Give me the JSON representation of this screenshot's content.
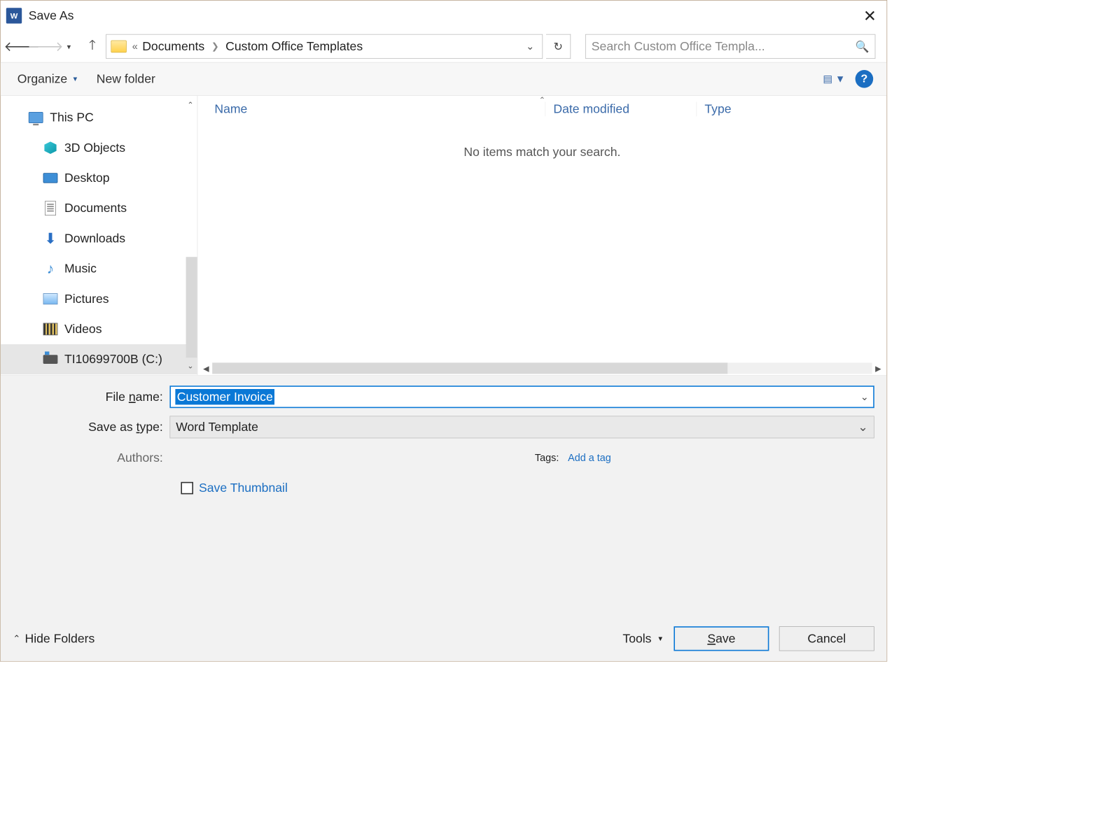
{
  "title": "Save As",
  "breadcrumb": {
    "parent": "Documents",
    "current": "Custom Office Templates"
  },
  "search_placeholder": "Search Custom Office Templa...",
  "toolbar": {
    "organize": "Organize",
    "new_folder": "New folder"
  },
  "tree": {
    "root": "This PC",
    "items": [
      "3D Objects",
      "Desktop",
      "Documents",
      "Downloads",
      "Music",
      "Pictures",
      "Videos",
      "TI10699700B (C:)"
    ]
  },
  "columns": {
    "name": "Name",
    "date": "Date modified",
    "type": "Type"
  },
  "empty_message": "No items match your search.",
  "form": {
    "filename_label_pre": "File ",
    "filename_label_u": "n",
    "filename_label_post": "ame:",
    "filename_value": "Customer Invoice",
    "type_label_pre": "Save as ",
    "type_label_u": "t",
    "type_label_post": "ype:",
    "type_value": "Word Template",
    "authors_label": "Authors:",
    "authors_value": "",
    "tags_label": "Tags:",
    "tags_value": "Add a tag",
    "thumbnail_label": "Save Thumbnail"
  },
  "footer": {
    "hide_folders": "Hide Folders",
    "tools": "Tools",
    "save_u": "S",
    "save_post": "ave",
    "cancel": "Cancel"
  }
}
